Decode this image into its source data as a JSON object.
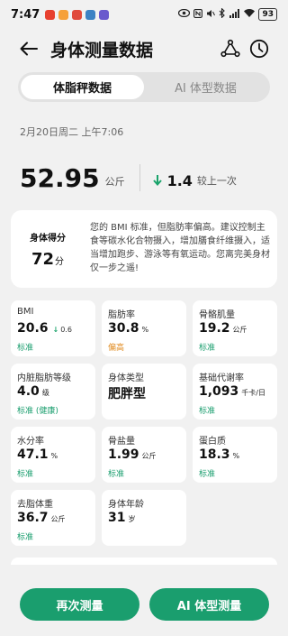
{
  "status_bar": {
    "time": "7:47",
    "app_colors": [
      "#e7402f",
      "#f6a13a",
      "#e04a3c",
      "#3b82c4",
      "#6a5acd"
    ],
    "battery": "93"
  },
  "header": {
    "title": "身体测量数据"
  },
  "tabs": [
    {
      "label": "体脂秤数据",
      "active": true
    },
    {
      "label": "AI 体型数据",
      "active": false
    }
  ],
  "date": "2月20日周二 上午7:06",
  "weight": {
    "value": "52.95",
    "unit": "公斤",
    "delta_value": "1.4",
    "delta_label": "较上一次",
    "delta_direction": "down"
  },
  "score": {
    "title": "身体得分",
    "value": "72",
    "unit": "分",
    "summary": "您的 BMI 标准，但脂肪率偏高。建议控制主食等碳水化合物摄入，增加膳食纤维摄入，适当增加跑步、游泳等有氧运动。您离完美身材仅一步之遥!"
  },
  "metrics": [
    {
      "label": "BMI",
      "value": "20.6",
      "unit": "",
      "delta": "0.6",
      "status": "标准",
      "status_color": "#1a9e6e"
    },
    {
      "label": "脂肪率",
      "value": "30.8",
      "unit": "%",
      "status": "偏高",
      "status_color": "#e08a1e"
    },
    {
      "label": "骨骼肌量",
      "value": "19.2",
      "unit": "公斤",
      "status": "标准",
      "status_color": "#1a9e6e"
    },
    {
      "label": "内脏脂肪等级",
      "value": "4.0",
      "unit": "级",
      "status": "标准 (健康)",
      "status_color": "#1a9e6e"
    },
    {
      "label": "身体类型",
      "value": "肥胖型",
      "unit": "",
      "status": "",
      "status_color": "#1a9e6e"
    },
    {
      "label": "基础代谢率",
      "value": "1,093",
      "unit": "千卡/日",
      "status": "标准",
      "status_color": "#1a9e6e"
    },
    {
      "label": "水分率",
      "value": "47.1",
      "unit": "%",
      "status": "标准",
      "status_color": "#1a9e6e"
    },
    {
      "label": "骨盐量",
      "value": "1.99",
      "unit": "公斤",
      "status": "标准",
      "status_color": "#1a9e6e"
    },
    {
      "label": "蛋白质",
      "value": "18.3",
      "unit": "%",
      "status": "标准",
      "status_color": "#1a9e6e"
    },
    {
      "label": "去脂体重",
      "value": "36.7",
      "unit": "公斤",
      "status": "标准",
      "status_color": "#1a9e6e"
    },
    {
      "label": "身体年龄",
      "value": "31",
      "unit": "岁",
      "status": "",
      "status_color": "#1a9e6e"
    }
  ],
  "buttons": {
    "remeasure": "再次测量",
    "ai_measure": "AI 体型测量"
  },
  "colors": {
    "accent": "#1a9e6e",
    "warning": "#e08a1e"
  }
}
